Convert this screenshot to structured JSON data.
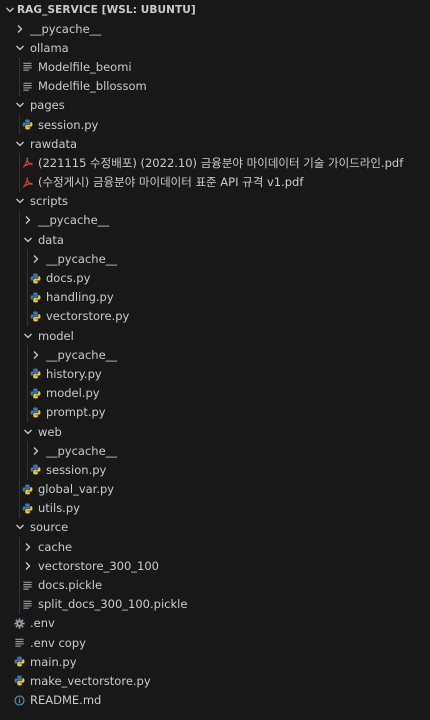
{
  "explorer": {
    "title": "RAG_SERVICE [WSL: UBUNTU]",
    "items": [
      {
        "label": "__pycache__",
        "depth": 1,
        "type": "folder",
        "open": false,
        "name": "folder-pycache-root"
      },
      {
        "label": "ollama",
        "depth": 1,
        "type": "folder",
        "open": true,
        "name": "folder-ollama"
      },
      {
        "label": "Modelfile_beomi",
        "depth": 2,
        "type": "file",
        "icon": "lines",
        "name": "file-modelfile-beomi"
      },
      {
        "label": "Modelfile_bllossom",
        "depth": 2,
        "type": "file",
        "icon": "lines",
        "name": "file-modelfile-bllossom"
      },
      {
        "label": "pages",
        "depth": 1,
        "type": "folder",
        "open": true,
        "name": "folder-pages"
      },
      {
        "label": "session.py",
        "depth": 2,
        "type": "file",
        "icon": "python",
        "name": "file-pages-session-py"
      },
      {
        "label": "rawdata",
        "depth": 1,
        "type": "folder",
        "open": true,
        "name": "folder-rawdata"
      },
      {
        "label": "(221115 수정배포) (2022.10) 금융분야 마이데이터 기술 가이드라인.pdf",
        "depth": 2,
        "type": "file",
        "icon": "pdf",
        "name": "file-pdf-guideline"
      },
      {
        "label": "(수정게시) 금융분야 마이데이터 표준 API 규격 v1.pdf",
        "depth": 2,
        "type": "file",
        "icon": "pdf",
        "name": "file-pdf-api-spec"
      },
      {
        "label": "scripts",
        "depth": 1,
        "type": "folder",
        "open": true,
        "name": "folder-scripts"
      },
      {
        "label": "__pycache__",
        "depth": 2,
        "type": "folder",
        "open": false,
        "name": "folder-scripts-pycache"
      },
      {
        "label": "data",
        "depth": 2,
        "type": "folder",
        "open": true,
        "name": "folder-scripts-data"
      },
      {
        "label": "__pycache__",
        "depth": 3,
        "type": "folder",
        "open": false,
        "name": "folder-data-pycache"
      },
      {
        "label": "docs.py",
        "depth": 3,
        "type": "file",
        "icon": "python",
        "name": "file-docs-py"
      },
      {
        "label": "handling.py",
        "depth": 3,
        "type": "file",
        "icon": "python",
        "name": "file-handling-py"
      },
      {
        "label": "vectorstore.py",
        "depth": 3,
        "type": "file",
        "icon": "python",
        "name": "file-vectorstore-py"
      },
      {
        "label": "model",
        "depth": 2,
        "type": "folder",
        "open": true,
        "name": "folder-scripts-model"
      },
      {
        "label": "__pycache__",
        "depth": 3,
        "type": "folder",
        "open": false,
        "name": "folder-model-pycache"
      },
      {
        "label": "history.py",
        "depth": 3,
        "type": "file",
        "icon": "python",
        "name": "file-history-py"
      },
      {
        "label": "model.py",
        "depth": 3,
        "type": "file",
        "icon": "python",
        "name": "file-model-py"
      },
      {
        "label": "prompt.py",
        "depth": 3,
        "type": "file",
        "icon": "python",
        "name": "file-prompt-py"
      },
      {
        "label": "web",
        "depth": 2,
        "type": "folder",
        "open": true,
        "name": "folder-scripts-web"
      },
      {
        "label": "__pycache__",
        "depth": 3,
        "type": "folder",
        "open": false,
        "name": "folder-web-pycache"
      },
      {
        "label": "session.py",
        "depth": 3,
        "type": "file",
        "icon": "python",
        "name": "file-web-session-py"
      },
      {
        "label": "global_var.py",
        "depth": 2,
        "type": "file",
        "icon": "python",
        "name": "file-global-var-py"
      },
      {
        "label": "utils.py",
        "depth": 2,
        "type": "file",
        "icon": "python",
        "name": "file-utils-py"
      },
      {
        "label": "source",
        "depth": 1,
        "type": "folder",
        "open": true,
        "name": "folder-source"
      },
      {
        "label": "cache",
        "depth": 2,
        "type": "folder",
        "open": false,
        "name": "folder-cache"
      },
      {
        "label": "vectorstore_300_100",
        "depth": 2,
        "type": "folder",
        "open": false,
        "name": "folder-vectorstore-300-100"
      },
      {
        "label": "docs.pickle",
        "depth": 2,
        "type": "file",
        "icon": "lines",
        "name": "file-docs-pickle"
      },
      {
        "label": "split_docs_300_100.pickle",
        "depth": 2,
        "type": "file",
        "icon": "lines",
        "name": "file-split-docs-pickle"
      },
      {
        "label": ".env",
        "depth": 1,
        "type": "file",
        "icon": "gear",
        "name": "file-env"
      },
      {
        "label": ".env copy",
        "depth": 1,
        "type": "file",
        "icon": "lines",
        "name": "file-env-copy"
      },
      {
        "label": "main.py",
        "depth": 1,
        "type": "file",
        "icon": "python",
        "name": "file-main-py"
      },
      {
        "label": "make_vectorstore.py",
        "depth": 1,
        "type": "file",
        "icon": "python",
        "name": "file-make-vectorstore-py"
      },
      {
        "label": "README.md",
        "depth": 1,
        "type": "file",
        "icon": "info",
        "name": "file-readme-md"
      }
    ]
  },
  "colors": {
    "background": "#181818",
    "text": "#cccccc",
    "guide": "#333333",
    "python_blue": "#3b7ab8",
    "python_yellow": "#f0c93a",
    "pdf_red": "#e0443e",
    "icon_grey": "#9da0a4",
    "info_blue": "#519aba"
  }
}
